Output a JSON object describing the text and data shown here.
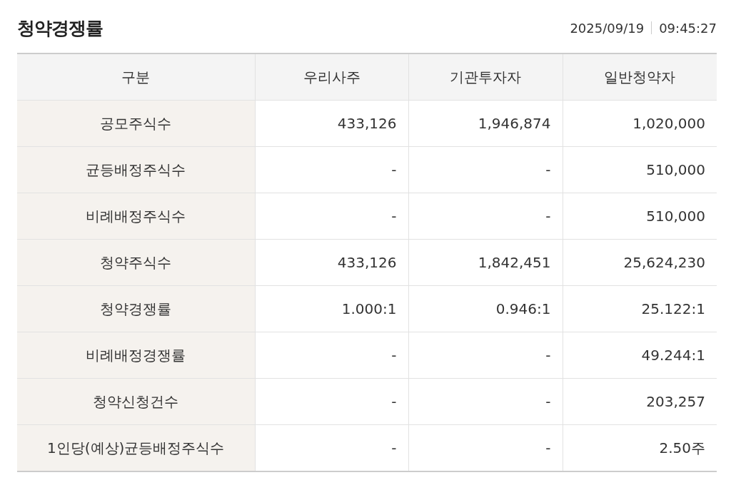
{
  "title": "청약경쟁률",
  "date": "2025/09/19",
  "time": "09:45:27",
  "table": {
    "columns": [
      "구분",
      "우리사주",
      "기관투자자",
      "일반청약자"
    ],
    "rows": [
      {
        "label": "공모주식수",
        "values": [
          "433,126",
          "1,946,874",
          "1,020,000"
        ]
      },
      {
        "label": "균등배정주식수",
        "values": [
          "-",
          "-",
          "510,000"
        ]
      },
      {
        "label": "비례배정주식수",
        "values": [
          "-",
          "-",
          "510,000"
        ]
      },
      {
        "label": "청약주식수",
        "values": [
          "433,126",
          "1,842,451",
          "25,624,230"
        ]
      },
      {
        "label": "청약경쟁률",
        "values": [
          "1.000:1",
          "0.946:1",
          "25.122:1"
        ]
      },
      {
        "label": "비례배정경쟁률",
        "values": [
          "-",
          "-",
          "49.244:1"
        ]
      },
      {
        "label": "청약신청건수",
        "values": [
          "-",
          "-",
          "203,257"
        ]
      },
      {
        "label": "1인당(예상)균등배정주식수",
        "values": [
          "-",
          "-",
          "2.50주"
        ]
      }
    ]
  }
}
